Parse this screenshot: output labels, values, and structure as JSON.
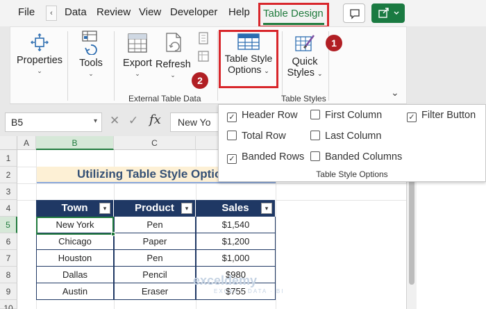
{
  "menu": {
    "items": [
      "File",
      "Data",
      "Review",
      "View",
      "Developer",
      "Help"
    ],
    "back_glyph": "‹",
    "active_tab": "Table Design"
  },
  "ribbon": {
    "properties_label": "Properties",
    "tools_label": "Tools",
    "export_label": "Export",
    "refresh_label": "Refresh",
    "table_style_options_label_1": "Table Style",
    "table_style_options_label_2": "Options",
    "quick_styles_label_1": "Quick",
    "quick_styles_label_2": "Styles",
    "group_external": "External Table Data",
    "group_table_styles": "Table Styles",
    "caret": "⌄",
    "collapse_glyph": "⌄"
  },
  "badges": {
    "badge1": "1",
    "badge2": "2"
  },
  "formula_bar": {
    "name_box": "B5",
    "formula_value": "New Yo"
  },
  "grid": {
    "columns": [
      "A",
      "B",
      "C"
    ],
    "rows": [
      "1",
      "2",
      "3",
      "4",
      "5",
      "6",
      "7",
      "8",
      "9",
      "10"
    ]
  },
  "sheet": {
    "title": "Utilizing Table Style Optio",
    "headers": [
      "Town",
      "Product",
      "Sales"
    ],
    "rows": [
      [
        "New York",
        "Pen",
        "$1,540"
      ],
      [
        "Chicago",
        "Paper",
        "$1,200"
      ],
      [
        "Houston",
        "Pen",
        "$1,000"
      ],
      [
        "Dallas",
        "Pencil",
        "$980"
      ],
      [
        "Austin",
        "Eraser",
        "$755"
      ]
    ]
  },
  "panel": {
    "options": [
      {
        "label": "Header Row",
        "checked": true
      },
      {
        "label": "First Column",
        "checked": false
      },
      {
        "label": "Filter Button",
        "checked": true
      },
      {
        "label": "Total Row",
        "checked": false
      },
      {
        "label": "Last Column",
        "checked": false
      },
      {
        "label": "Banded Rows",
        "checked": true
      },
      {
        "label": "Banded Columns",
        "checked": false
      }
    ],
    "group_label": "Table Style Options"
  },
  "watermark": {
    "name": "exceldemy",
    "tag": "EXCEL · DATA · BI"
  },
  "colors": {
    "accent_green": "#1f7a3c",
    "highlight_red": "#d8262b",
    "table_header": "#1f3864",
    "title_fill": "#fdf0d5"
  }
}
